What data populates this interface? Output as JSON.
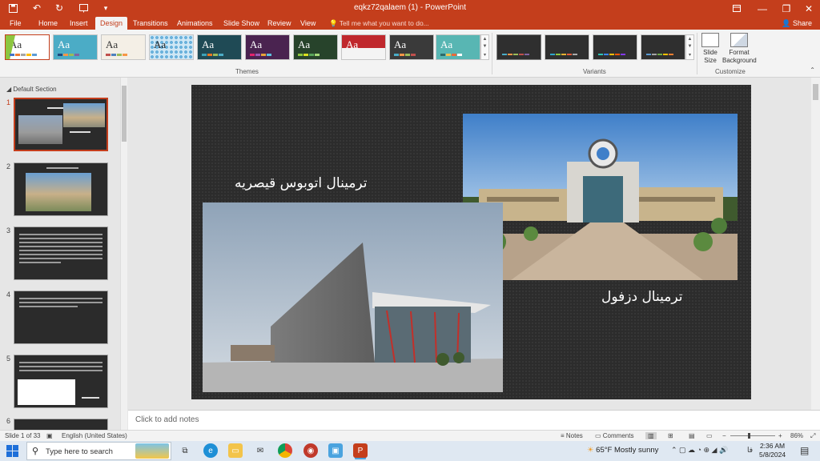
{
  "titlebar": {
    "title": "eqkz72qalaem (1) - PowerPoint",
    "accent": "#c43e1c"
  },
  "tabs": [
    "File",
    "Home",
    "Insert",
    "Design",
    "Transitions",
    "Animations",
    "Slide Show",
    "Review",
    "View"
  ],
  "active_tab": "Design",
  "tell_me": "Tell me what you want to do...",
  "share": "Share",
  "ribbon": {
    "themes_label": "Themes",
    "variants_label": "Variants",
    "customize_label": "Customize",
    "slide_size": "Slide Size",
    "format_background": "Format Background",
    "theme_sample": "Aa"
  },
  "thumbnails": {
    "section": "Default Section",
    "numbers": [
      "1",
      "2",
      "3",
      "4",
      "5",
      "6"
    ]
  },
  "slide": {
    "title_qeysarieh": "ترمینال اتوبوس قیصریه",
    "title_dezful": "ترمینال دزفول"
  },
  "notes_placeholder": "Click to add notes",
  "status": {
    "slide_count": "Slide 1 of 33",
    "language": "English (United States)",
    "notes": "Notes",
    "comments": "Comments",
    "zoom": "86%"
  },
  "taskbar": {
    "search_placeholder": "Type here to search",
    "weather": "65°F  Mostly sunny",
    "time": "2:36 AM",
    "date": "5/8/2024",
    "lang": "ﻓﺎ"
  }
}
